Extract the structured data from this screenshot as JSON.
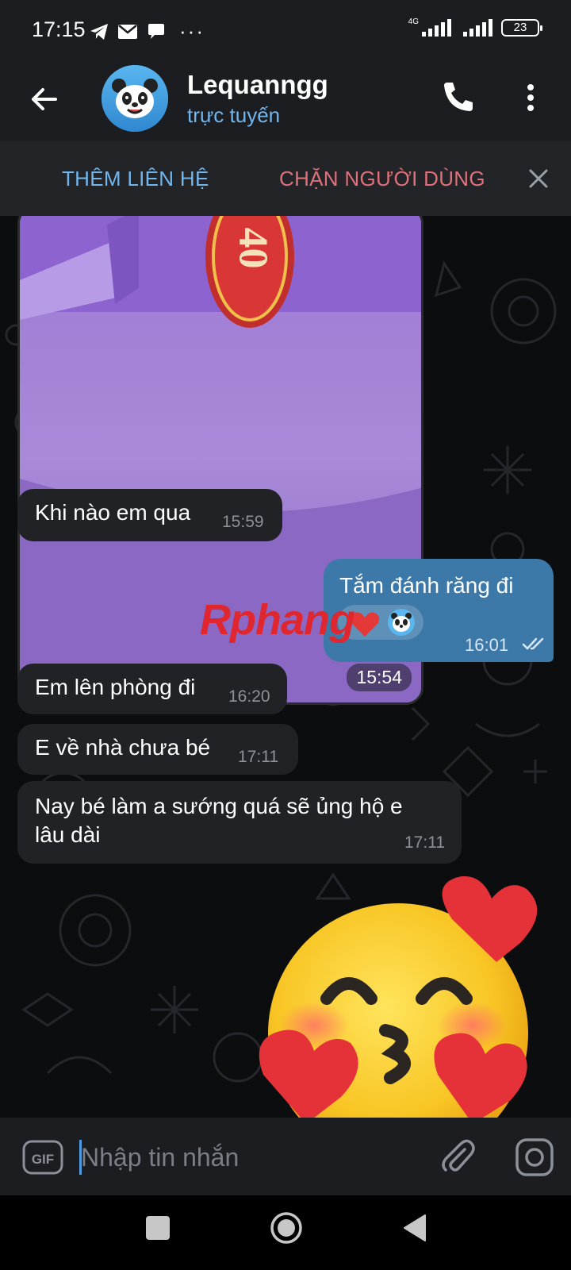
{
  "status_bar": {
    "time": "17:15",
    "notification_icons": [
      "telegram-icon",
      "mail-icon",
      "chat-bubble-icon",
      "more-dots"
    ],
    "network_label": "4G",
    "battery": "23"
  },
  "header": {
    "contact_name": "Lequanngg",
    "contact_status": "trực tuyến",
    "avatar_icon": "panda-avatar"
  },
  "action_bar": {
    "add_contact": "THÊM LIÊN HỆ",
    "block_user": "CHẶN NGƯỜI DÙNG"
  },
  "messages": [
    {
      "type": "photo",
      "direction": "in",
      "time": "15:54",
      "photo_text": "40"
    },
    {
      "type": "text",
      "direction": "in",
      "text": "Khi nào em qua",
      "time": "15:59"
    },
    {
      "type": "text",
      "direction": "out",
      "text": "Tắm đánh răng đi",
      "time": "16:01",
      "status": "read",
      "reactions": [
        "heart",
        "panda"
      ]
    },
    {
      "type": "text",
      "direction": "in",
      "text": "Em lên phòng đi",
      "time": "16:20"
    },
    {
      "type": "text",
      "direction": "in",
      "text": "E về nhà chưa bé",
      "time": "17:11"
    },
    {
      "type": "text",
      "direction": "in",
      "text_line1": "Nay bé làm a sướng quá sẽ ủng hộ e",
      "text_line2": "lâu dài",
      "time": "17:11"
    },
    {
      "type": "sticker",
      "direction": "in",
      "sticker": "kissing-face-with-hearts"
    }
  ],
  "watermark": {
    "part1": "Rphang",
    "part2": ""
  },
  "input": {
    "placeholder": "Nhập tin nhắn",
    "gif_label": "GIF"
  },
  "colors": {
    "header_bg": "#1c1d21",
    "accent_blue": "#73b6eb",
    "block_red": "#e0707a",
    "outgoing_bubble": "#3c78a8",
    "incoming_bubble": "#212226"
  }
}
